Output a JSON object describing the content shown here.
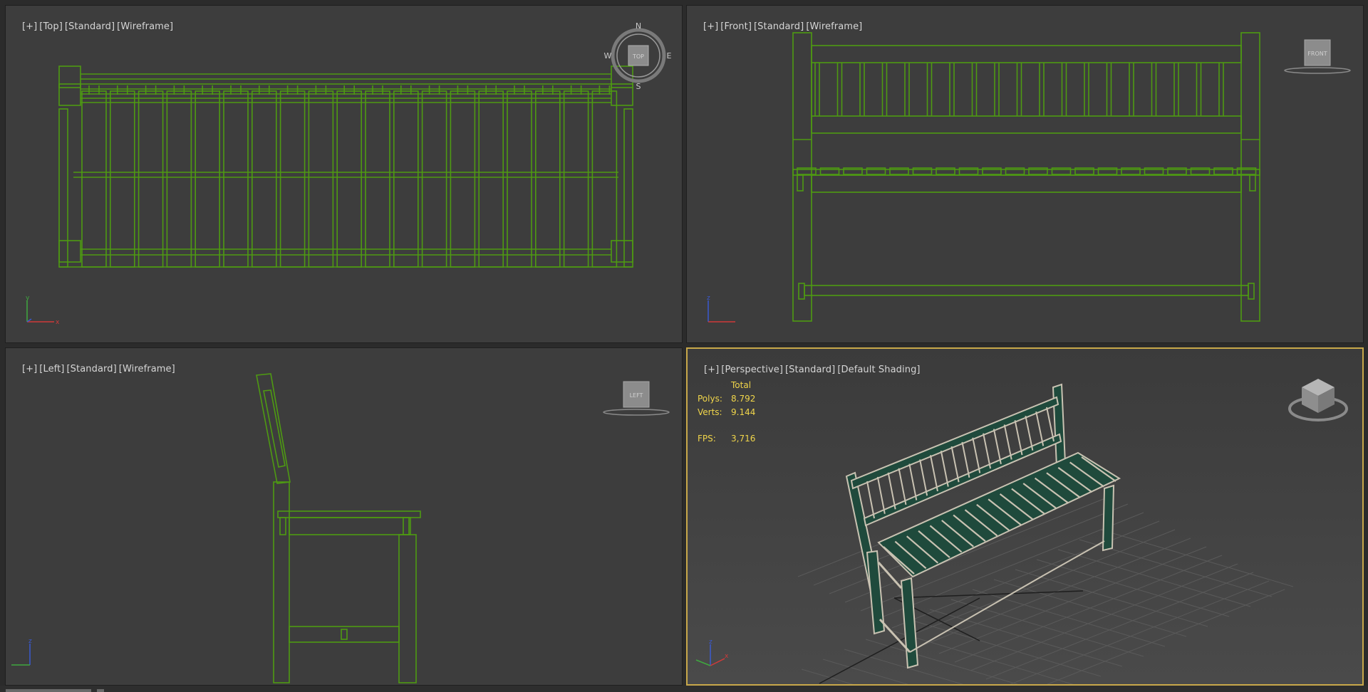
{
  "viewports": {
    "top": {
      "label": [
        "[+]",
        "[Top]",
        "[Standard]",
        "[Wireframe]"
      ],
      "cube_label": "TOP",
      "compass": [
        "N",
        "E",
        "S",
        "W"
      ]
    },
    "front": {
      "label": [
        "[+]",
        "[Front]",
        "[Standard]",
        "[Wireframe]"
      ],
      "cube_label": "FRONT"
    },
    "left": {
      "label": [
        "[+]",
        "[Left]",
        "[Standard]",
        "[Wireframe]"
      ],
      "cube_label": "LEFT"
    },
    "perspective": {
      "label": [
        "[+]",
        "[Perspective]",
        "[Standard]",
        "[Default Shading]"
      ],
      "stats": {
        "header": "Total",
        "polys_label": "Polys:",
        "polys_value": "8.792",
        "verts_label": "Verts:",
        "verts_value": "9.144",
        "fps_label": "FPS:",
        "fps_value": "3,716"
      }
    }
  },
  "colors": {
    "wire": "#4e9a12",
    "viewport_bg": "#3d3d3d",
    "active_border": "#c8a84a",
    "stats_text": "#f0d54a",
    "bench_green": "#1f4a3c",
    "bench_edge": "#c9c2b2"
  },
  "axis_labels": {
    "x": "x",
    "y": "y",
    "z": "z"
  }
}
